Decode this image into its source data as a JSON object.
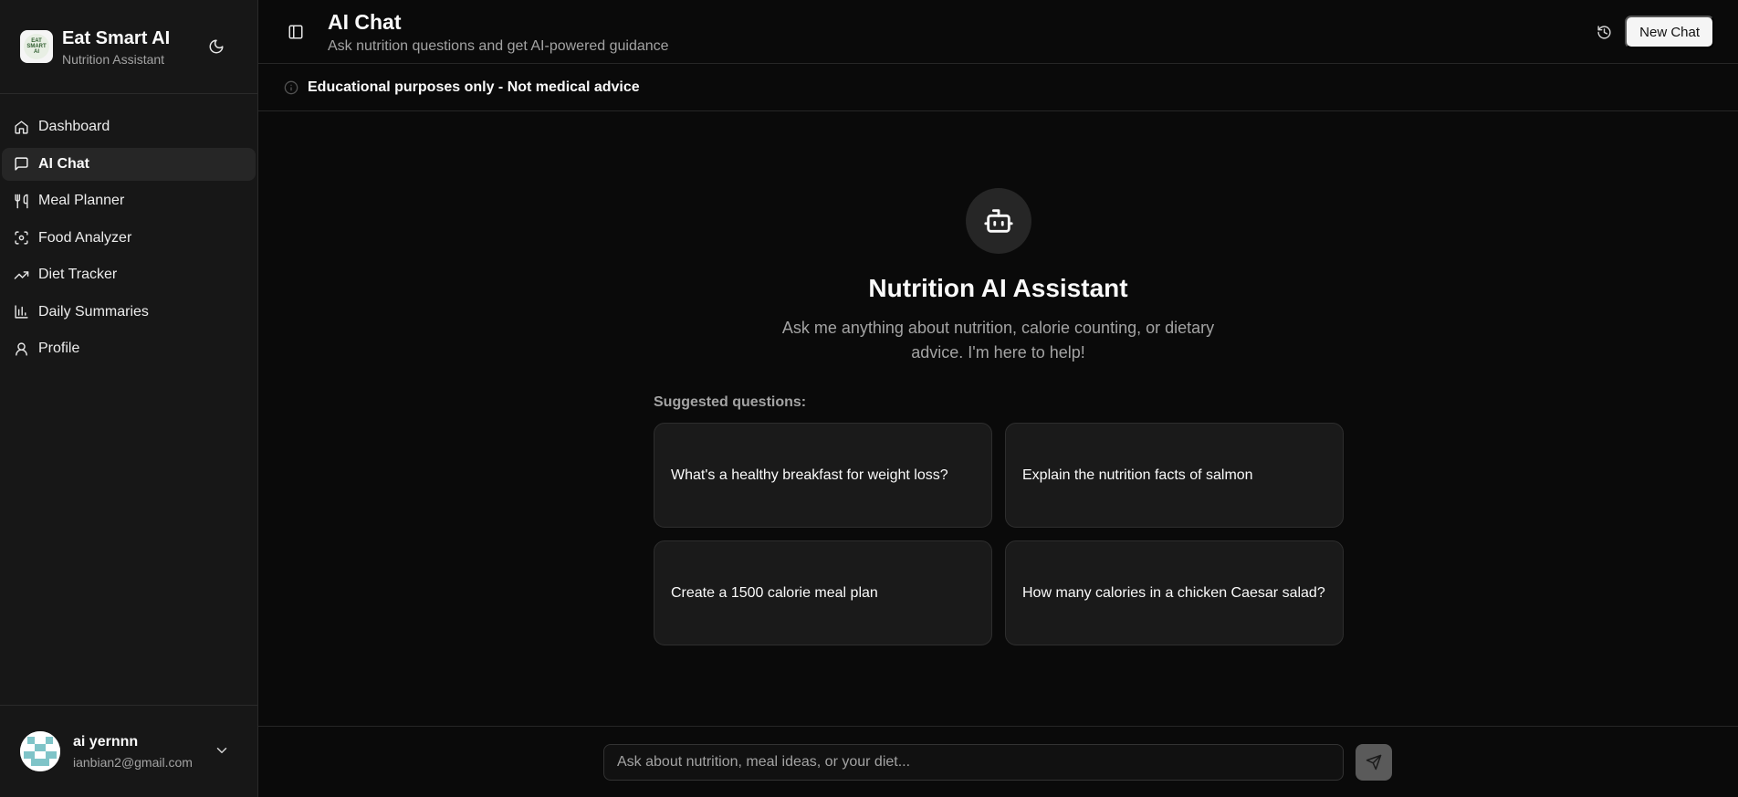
{
  "brand": {
    "title": "Eat Smart AI",
    "subtitle": "Nutrition Assistant",
    "logo_text": "EAT SMART AI"
  },
  "sidebar": {
    "items": [
      {
        "label": "Dashboard",
        "icon": "home-icon",
        "active": false
      },
      {
        "label": "AI Chat",
        "icon": "message-square-icon",
        "active": true
      },
      {
        "label": "Meal Planner",
        "icon": "utensils-icon",
        "active": false
      },
      {
        "label": "Food Analyzer",
        "icon": "scan-icon",
        "active": false
      },
      {
        "label": "Diet Tracker",
        "icon": "trending-up-icon",
        "active": false
      },
      {
        "label": "Daily Summaries",
        "icon": "bar-chart-icon",
        "active": false
      },
      {
        "label": "Profile",
        "icon": "user-icon",
        "active": false
      }
    ]
  },
  "user": {
    "name": "ai yernnn",
    "email": "ianbian2@gmail.com"
  },
  "header": {
    "title": "AI Chat",
    "subtitle": "Ask nutrition questions and get AI-powered guidance",
    "new_chat_label": "New Chat"
  },
  "disclaimer": {
    "text": "Educational purposes only - Not medical advice"
  },
  "hero": {
    "title": "Nutrition AI Assistant",
    "subtitle": "Ask me anything about nutrition, calorie counting, or dietary advice. I'm here to help!"
  },
  "suggestions": {
    "label": "Suggested questions:",
    "items": [
      "What's a healthy breakfast for weight loss?",
      "Explain the nutrition facts of salmon",
      "Create a 1500 calorie meal plan",
      "How many calories in a chicken Caesar salad?"
    ]
  },
  "composer": {
    "placeholder": "Ask about nutrition, meal ideas, or your diet...",
    "value": ""
  },
  "colors": {
    "background": "#0a0a0a",
    "sidebar": "#171717",
    "card": "#1a1a1a",
    "text": "#fafafa",
    "muted": "#a3a3a3",
    "button_light": "#f5f5f5",
    "send_button": "#5a5a5a"
  }
}
